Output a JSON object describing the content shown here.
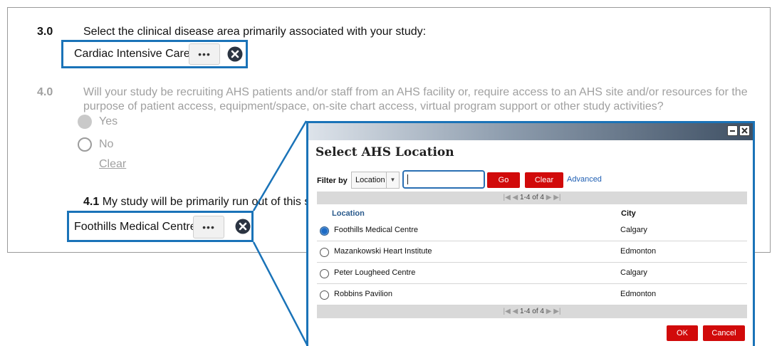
{
  "q3": {
    "number": "3.0",
    "text": "Select the clinical disease area primarily associated with your study:",
    "selected_value": "Cardiac Intensive Care",
    "dots_label": "•••"
  },
  "q4": {
    "number": "4.0",
    "text_line1": "Will your study be recruiting AHS patients and/or staff from an AHS facility or, require access to an AHS site and/or resources for the",
    "text_line2": "purpose of patient access, equipment/space, on-site chart access, virtual program support or other study activities?",
    "options": [
      {
        "label": "Yes",
        "selected": true
      },
      {
        "label": "No",
        "selected": false
      }
    ],
    "clear_label": "Clear"
  },
  "q41": {
    "number": "4.1",
    "text": " My study will be primarily run out of this site:",
    "selected_value": "Foothills Medical Centre",
    "dots_label": "•••"
  },
  "modal": {
    "title": "Select AHS Location",
    "filter_label": "Filter by",
    "filter_field": "Location",
    "filter_value": "",
    "go_label": "Go",
    "clear_label": "Clear",
    "advanced_label": "Advanced",
    "pager_text": "1-4 of 4",
    "columns": {
      "location": "Location",
      "city": "City"
    },
    "rows": [
      {
        "location": "Foothills Medical Centre",
        "city": "Calgary",
        "selected": true
      },
      {
        "location": "Mazankowski Heart Institute",
        "city": "Edmonton",
        "selected": false
      },
      {
        "location": "Peter Lougheed Centre",
        "city": "Calgary",
        "selected": false
      },
      {
        "location": "Robbins Pavilion",
        "city": "Edmonton",
        "selected": false
      }
    ],
    "ok_label": "OK",
    "cancel_label": "Cancel"
  },
  "colors": {
    "accent_blue": "#1a73b8",
    "action_red": "#d10a0a",
    "link_blue": "#1f5fb3"
  }
}
